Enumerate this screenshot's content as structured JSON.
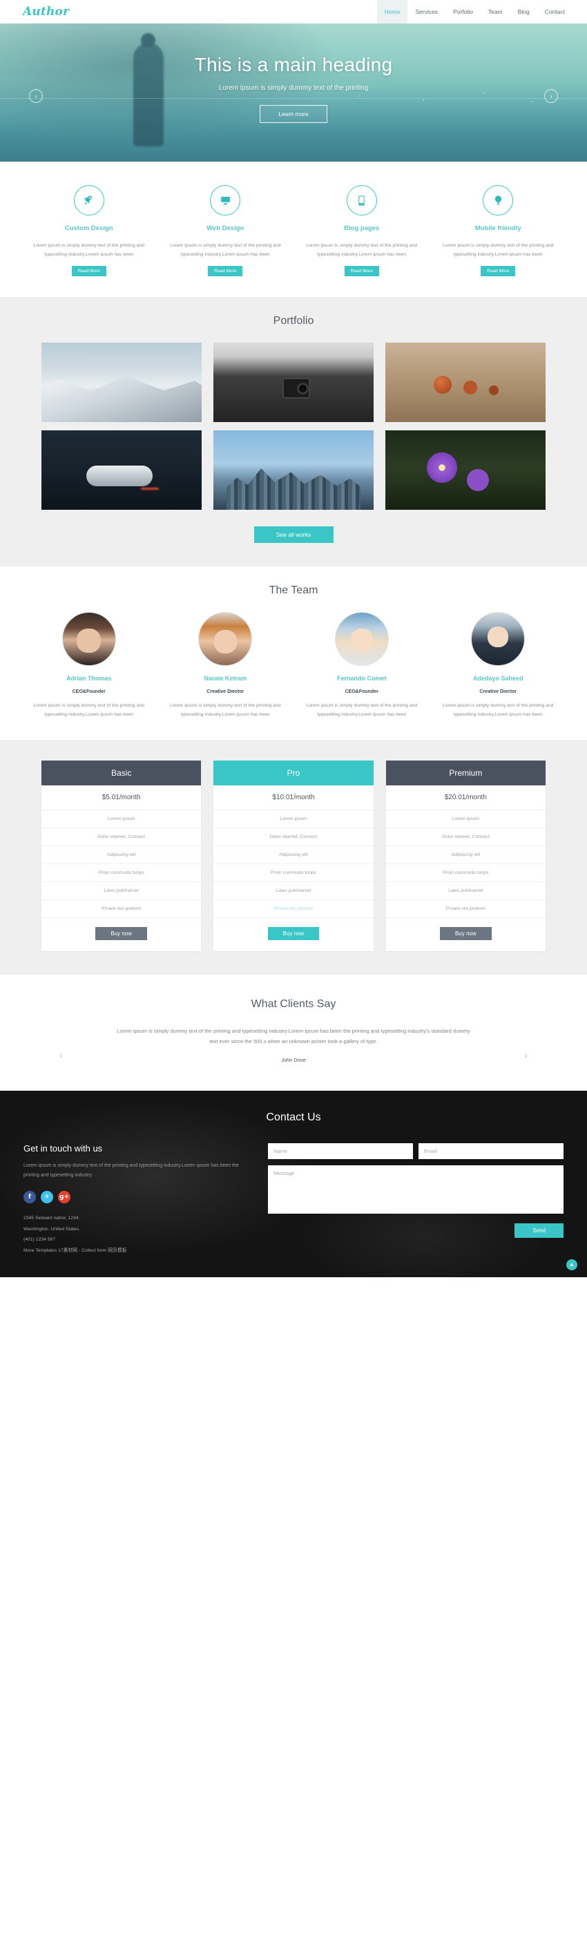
{
  "nav": {
    "logo": "Author",
    "items": [
      {
        "label": "Home",
        "active": true
      },
      {
        "label": "Services",
        "active": false
      },
      {
        "label": "Porfolio",
        "active": false
      },
      {
        "label": "Team",
        "active": false
      },
      {
        "label": "Blog",
        "active": false
      },
      {
        "label": "Contact",
        "active": false
      }
    ]
  },
  "hero": {
    "heading": "This is a main heading",
    "subheading": "Lorem ipsum is simply dummy text of the printing",
    "cta": "Learn more",
    "prev": "‹",
    "next": "›"
  },
  "features": [
    {
      "icon": "rocket-icon",
      "title": "Custom Design",
      "desc": "Lorem ipsum is simply dummy text of the printing and typesetting industry.Lorem ipsum has been",
      "button": "Read More"
    },
    {
      "icon": "monitor-icon",
      "title": "Web Design",
      "desc": "Lorem ipsum is simply dummy text of the printing and typesetting industry.Lorem ipsum has been",
      "button": "Read More"
    },
    {
      "icon": "tablet-icon",
      "title": "Blog pages",
      "desc": "Lorem ipsum is simply dummy text of the printing and typesetting industry.Lorem ipsum has been",
      "button": "Read More"
    },
    {
      "icon": "lightbulb-icon",
      "title": "Mobile friendly",
      "desc": "Lorem ipsum is simply dummy text of the printing and typesetting industry.Lorem ipsum has been",
      "button": "Read More"
    }
  ],
  "portfolio": {
    "title": "Portfolio",
    "items": [
      {
        "name": "snow-mountains-thumb"
      },
      {
        "name": "photographer-camera-thumb"
      },
      {
        "name": "acorns-wood-thumb"
      },
      {
        "name": "game-controller-thumb"
      },
      {
        "name": "city-skyline-thumb"
      },
      {
        "name": "purple-flowers-thumb"
      }
    ],
    "button": "See all works"
  },
  "team": {
    "title": "The Team",
    "members": [
      {
        "name": "Adrian Thomas",
        "role": "CEO&Founder",
        "desc": "Lorem ipsum is simply dummy text of the printing and typesetting industry.Lorem ipsum has been"
      },
      {
        "name": "Narate Ketram",
        "role": "Creative Diector",
        "desc": "Lorem ipsum is simply dummy text of the printing and typesetting industry.Lorem ipsum has been"
      },
      {
        "name": "Fernando Comet",
        "role": "CEO&Founder",
        "desc": "Lorem ipsum is simply dummy text of the printing and typesetting industry.Lorem ipsum has been"
      },
      {
        "name": "Adedayo Saheed",
        "role": "Creative Diector",
        "desc": "Lorem ipsum is simply dummy text of the printing and typesetting industry.Lorem ipsum has been"
      }
    ]
  },
  "pricing": {
    "plans": [
      {
        "name": "Basic",
        "price": "$5.01/month",
        "features": [
          "Lorem ipsum",
          "Dolor sitamet, Consect",
          "Adipiscing elit",
          "Proin commodo turips",
          "Laws pulvinarvel",
          "Prnare nisi pretium"
        ],
        "button": "Buy now",
        "highlight": false
      },
      {
        "name": "Pro",
        "price": "$10.01/month",
        "features": [
          "Lorem ipsum",
          "Dolor sitamet, Consect",
          "Adipiscing elit",
          "Proin commodo turips",
          "Laws pulvinarvel",
          "Prnare nisi pretium"
        ],
        "button": "Buy now",
        "highlight": true
      },
      {
        "name": "Premium",
        "price": "$20.01/month",
        "features": [
          "Lorem ipsum",
          "Dolor sitamet, Consect",
          "Adipiscing elit",
          "Proin commodo turips",
          "Laws pulvinarvel",
          "Prnare nisi pretium"
        ],
        "button": "Buy now",
        "highlight": false
      }
    ]
  },
  "testimonial": {
    "title": "What Clients Say",
    "quote": "Lorem ipsum is simply dummy text of the printing and typesetting industry.Lorem ipsum has been the printing and typesetting industry's standard dummy text ever since the 500,s when an unknown printer took a gallery of type.",
    "author": "John Dove",
    "prev": "‹",
    "next": "›"
  },
  "contact": {
    "title": "Contact Us",
    "get_in_touch": "Get in touch with us",
    "desc": "Lorem ipsum is simply dummy text of the printing and typesetting industry.Lorem ipsum has been the printing and typesetting industry.",
    "socials": [
      {
        "name": "facebook-icon",
        "glyph": "f"
      },
      {
        "name": "twitter-icon",
        "glyph": "✈"
      },
      {
        "name": "google-plus-icon",
        "glyph": "g+"
      }
    ],
    "address_line1": "2345 Setwant natrer, 1234",
    "address_line2": "Washington. United States.",
    "phone": "(401) 1234 567",
    "credit": "More Templates 17素材网 - Collect from 网页模板",
    "form": {
      "name_placeholder": "Name",
      "email_placeholder": "Email",
      "message_placeholder": "Message",
      "send": "Send"
    },
    "to_top": "▲"
  },
  "colors": {
    "accent": "#3ac6c6",
    "dark": "#49525e",
    "facebook": "#3b5998",
    "twitter": "#3fc1f2",
    "google": "#e9402a"
  }
}
